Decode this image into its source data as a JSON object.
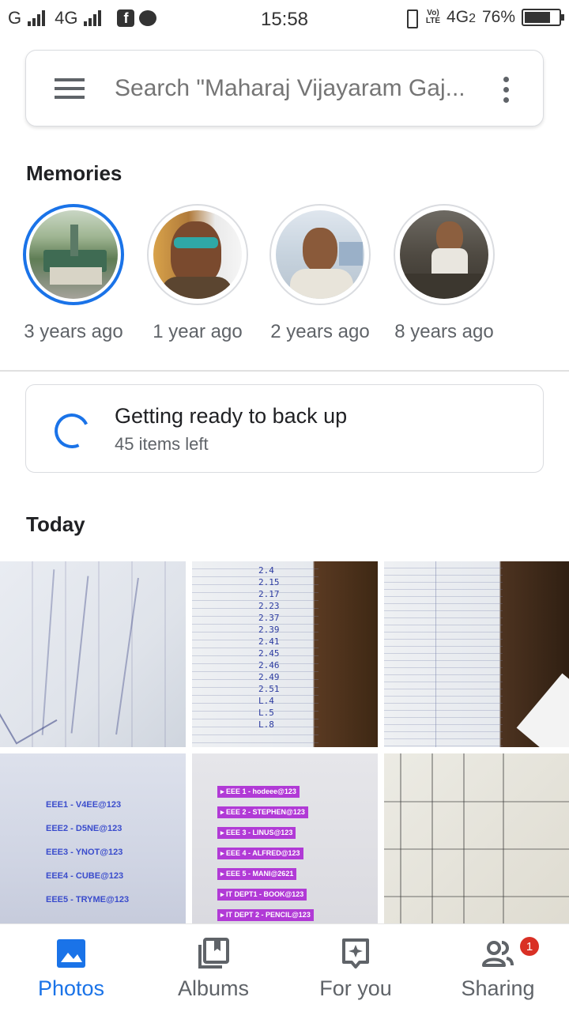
{
  "status_bar": {
    "carrier1": "G",
    "carrier2": "4G",
    "time": "15:58",
    "volte_top": "Vo)",
    "volte_bottom": "LTE",
    "network": "4G",
    "network_sub": "2",
    "battery": "76%",
    "battery_level": 0.76,
    "icons": [
      "signal-icon",
      "facebook-icon",
      "notification-icon",
      "vibrate-icon",
      "battery-icon"
    ]
  },
  "search": {
    "placeholder": "Search \"Maharaj Vijayaram Gaj..."
  },
  "memories": {
    "title": "Memories",
    "items": [
      {
        "label": "3 years ago"
      },
      {
        "label": "1 year ago"
      },
      {
        "label": "2 years ago"
      },
      {
        "label": "8 years ago"
      }
    ]
  },
  "backup": {
    "title": "Getting ready to back up",
    "subtitle": "45 items left"
  },
  "today": {
    "title": "Today",
    "photo4_lines": [
      "EEE1 - V4EE@123",
      "EEE2 - D5NE@123",
      "EEE3 - YNOT@123",
      "EEE4 - CUBE@123",
      "EEE5 - TRYME@123"
    ],
    "photo5_lines": [
      "EEE 1 - hodeee@123",
      "EEE 2 - STEPHEN@123",
      "EEE 3 - LINUS@123",
      "EEE 4 - ALFRED@123",
      "EEE 5 - MANI@2621",
      "IT DEPT1 - BOOK@123",
      "IT DEPT 2 - PENCIL@123"
    ],
    "photo2_numbers": [
      "2.4",
      "2.15",
      "2.17",
      "2.23",
      "2.37",
      "2.39",
      "2.41",
      "2.45",
      "2.46",
      "2.49",
      "2.51",
      "L.4",
      "L.5",
      "L.8"
    ]
  },
  "nav": {
    "photos": "Photos",
    "albums": "Albums",
    "for_you": "For you",
    "sharing": "Sharing",
    "sharing_badge": "1"
  },
  "colors": {
    "accent": "#1a73e8",
    "badge": "#d93025"
  }
}
